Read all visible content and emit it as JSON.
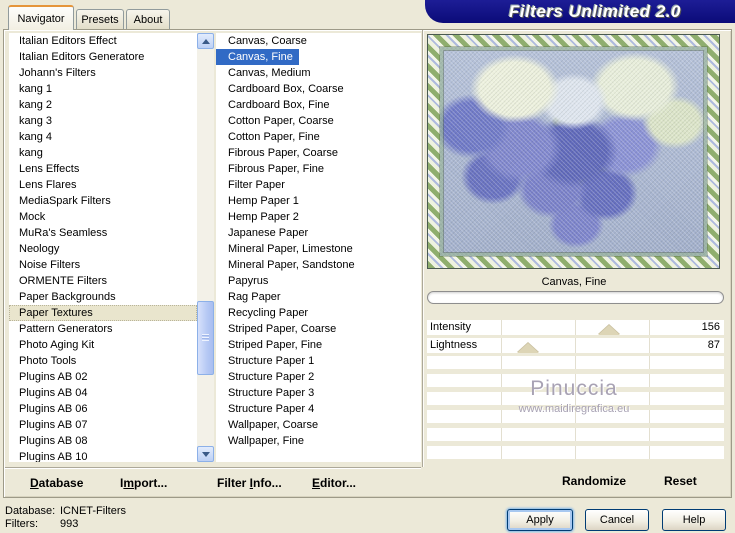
{
  "window": {
    "title": "Filters Unlimited 2.0"
  },
  "tabs": [
    {
      "label": "Navigator"
    },
    {
      "label": "Presets"
    },
    {
      "label": "About"
    }
  ],
  "left_list": {
    "selected_index": 17,
    "items": [
      "Italian Editors Effect",
      "Italian Editors Generatore",
      "Johann's Filters",
      "kang 1",
      "kang 2",
      "kang 3",
      "kang 4",
      "kang",
      "Lens Effects",
      "Lens Flares",
      "MediaSpark Filters",
      "Mock",
      "MuRa's Seamless",
      "Neology",
      "Noise Filters",
      "ORMENTE Filters",
      "Paper Backgrounds",
      "Paper Textures",
      "Pattern Generators",
      "Photo Aging Kit",
      "Photo Tools",
      "Plugins AB 02",
      "Plugins AB 04",
      "Plugins AB 06",
      "Plugins AB 07",
      "Plugins AB 08",
      "Plugins AB 10"
    ]
  },
  "middle_list": {
    "selected_index": 1,
    "items": [
      "Canvas, Coarse",
      "Canvas, Fine",
      "Canvas, Medium",
      "Cardboard Box, Coarse",
      "Cardboard Box, Fine",
      "Cotton Paper, Coarse",
      "Cotton Paper, Fine",
      "Fibrous Paper, Coarse",
      "Fibrous Paper, Fine",
      "Filter Paper",
      "Hemp Paper 1",
      "Hemp Paper 2",
      "Japanese Paper",
      "Mineral Paper, Limestone",
      "Mineral Paper, Sandstone",
      "Papyrus",
      "Rag Paper",
      "Recycling Paper",
      "Striped Paper, Coarse",
      "Striped Paper, Fine",
      "Structure Paper 1",
      "Structure Paper 2",
      "Structure Paper 3",
      "Structure Paper 4",
      "Wallpaper, Coarse",
      "Wallpaper, Fine"
    ]
  },
  "right_panel": {
    "preview_caption": "Canvas, Fine",
    "sliders": [
      {
        "label": "Intensity",
        "value": 156,
        "max": 255
      },
      {
        "label": "Lightness",
        "value": 87,
        "max": 255
      }
    ],
    "watermark": {
      "name": "Pinuccia",
      "url": "www.maidiregrafica.eu"
    },
    "randomize_label": "Randomize",
    "reset_label": "Reset"
  },
  "toolbar": {
    "items": [
      {
        "pre": "",
        "key": "D",
        "post": "atabase"
      },
      {
        "pre": "I",
        "key": "m",
        "post": "port..."
      },
      {
        "pre": "Filter ",
        "key": "I",
        "post": "nfo..."
      },
      {
        "pre": "",
        "key": "E",
        "post": "ditor..."
      }
    ]
  },
  "status": [
    {
      "label": "Database:",
      "value": "ICNET-Filters"
    },
    {
      "label": "Filters:",
      "value": "993"
    }
  ],
  "buttons": {
    "apply": "Apply",
    "cancel": "Cancel",
    "help": "Help"
  },
  "colors": {
    "dialog_bg": "#ece9d8",
    "banner": "#0b0b78",
    "selection_highlight": "#316ac5",
    "tab_accent": "#e5953a"
  }
}
